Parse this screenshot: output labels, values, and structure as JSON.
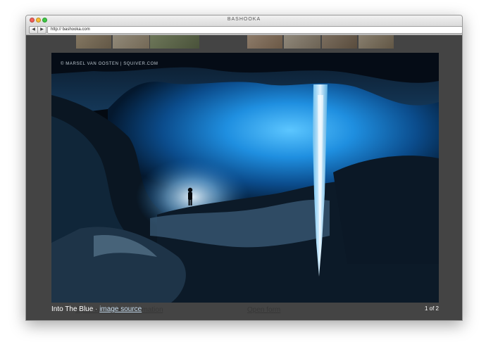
{
  "window": {
    "title": "BASHOOKA"
  },
  "toolbar": {
    "back_glyph": "◀",
    "forward_glyph": "▶",
    "url": "http:// bashooka.com"
  },
  "background": {
    "link_animation": "Open with fade-in animation",
    "link_form": "Open form"
  },
  "lightbox": {
    "watermark": "© MARSEL VAN OOSTEN | SQUIVER.COM",
    "caption_title": "Into The Blue",
    "caption_separator": " · ",
    "source_label": "image source",
    "counter": "1 of 2"
  },
  "colors": {
    "overlay": "#444444",
    "ice_blue": "#2a9ee8",
    "close_dot": "#f25f58",
    "min_dot": "#f8bd34",
    "max_dot": "#3ec944"
  }
}
